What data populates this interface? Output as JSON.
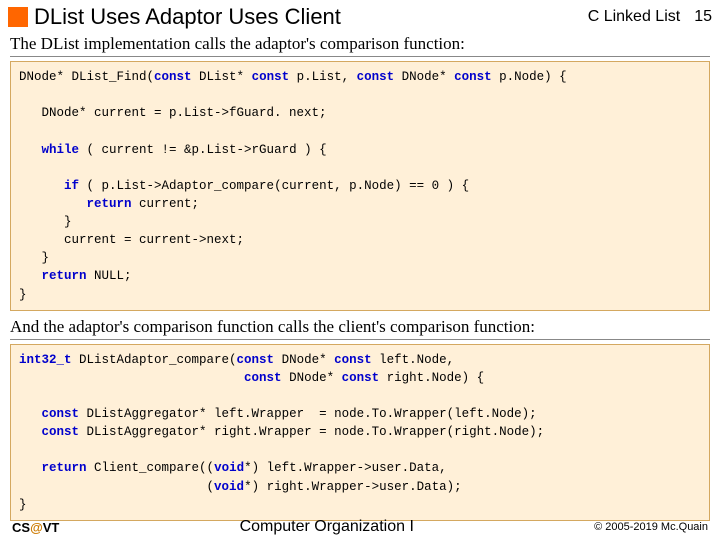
{
  "header": {
    "title": "DList Uses Adaptor Uses Client",
    "subtitle": "C Linked List",
    "page": "15"
  },
  "intro1": "The DList implementation calls the adaptor's comparison function:",
  "code1": {
    "l1a": "DNode* DList_Find(",
    "l1b": " DList* ",
    "l1c": " p.List, ",
    "l1d": " DNode* ",
    "l1e": " p.Node) {",
    "l2": "   DNode* current = p.List->fGuard. next;",
    "l3a": "   ",
    "l3b": " ( current != &p.List->rGuard ) {",
    "l4a": "      ",
    "l4b": " ( p.List->Adaptor_compare(current, p.Node) == 0 ) {",
    "l5a": "         ",
    "l5b": " current;",
    "l6": "      }",
    "l7": "      current = current->next;",
    "l8": "   }",
    "l9a": "   ",
    "l9b": " NULL;",
    "l10": "}",
    "kw_const": "const",
    "kw_while": "while",
    "kw_if": "if",
    "kw_return": "return"
  },
  "intro2": "And the adaptor's comparison function calls the client's comparison function:",
  "code2": {
    "l1a": " DListAdaptor_compare(",
    "l1b": " DNode* ",
    "l1c": " left.Node,",
    "l2a": "                              ",
    "l2b": " DNode* ",
    "l2c": " right.Node) {",
    "l3a": "   ",
    "l3b": " DListAggregator* left.Wrapper  = node.To.Wrapper(left.Node);",
    "l4a": "   ",
    "l4b": " DListAggregator* right.Wrapper = node.To.Wrapper(right.Node);",
    "l5a": "   ",
    "l5b": " Client_compare((",
    "l5c": "*) left.Wrapper->user.Data,",
    "l6a": "                         (",
    "l6b": "*) right.Wrapper->user.Data);",
    "l7": "}",
    "kw_int32": "int32_t",
    "kw_const": "const",
    "kw_return": "return",
    "kw_void": "void"
  },
  "footer": {
    "left_cs": "CS",
    "left_at": "@",
    "left_vt": "VT",
    "center": "Computer Organization I",
    "right": "© 2005-2019 Mc.Quain"
  }
}
